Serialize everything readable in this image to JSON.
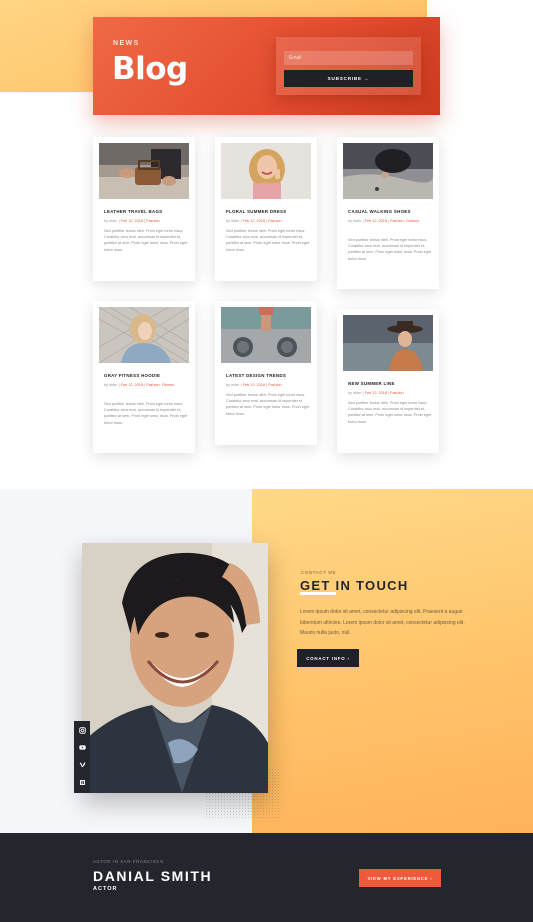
{
  "colors": {
    "accent": "#ef5a3c",
    "hero_start": "#ef6a47",
    "hero_end": "#cc3b1f",
    "dark": "#1e2128",
    "footer_bg": "#23262c",
    "yellow_start": "#ffd988",
    "yellow_end": "#ffb25a",
    "light_bg": "#f6f7fb"
  },
  "hero": {
    "kicker": "NEWS",
    "title": "Blog",
    "email_placeholder": "Email",
    "subscribe_label": "SUBSCRIBE",
    "subscribe_arrow": "→"
  },
  "posts": [
    {
      "title": "LEATHER TRAVEL BAGS",
      "author": "by elder",
      "date": "Feb 12, 2018",
      "category": "Fashion",
      "excerpt": "Sed porttitor lectus nibh. Proin eget tortor risus. Curabitur arcu erat, accumsan id imperdiet et, porttitor at sem. Proin eget tortor risus. Proin eget tortor risus.",
      "image": "hands-with-leather-bag"
    },
    {
      "title": "FLORAL SUMMER DRESS",
      "author": "by elder",
      "date": "Feb 12, 2018",
      "category": "Fashion",
      "excerpt": "Sed porttitor lectus nibh. Proin eget tortor risus. Curabitur arcu erat, accumsan id imperdiet et, porttitor at sem. Proin eget tortor risus. Proin eget tortor risus.",
      "image": "smiling-blonde-woman"
    },
    {
      "title": "CASUAL WALKING SHOES",
      "author": "by elder",
      "date": "Feb 12, 2018",
      "category": "Fashion, Outdoor",
      "excerpt": "Sed porttitor lectus nibh. Proin eget tortor risus. Curabitur arcu erat, accumsan id imperdiet et, porttitor at sem. Proin eget tortor risus. Proin eget tortor risus.",
      "image": "person-at-water-edge"
    },
    {
      "title": "GRAY FITNESS HOODIE",
      "author": "by elder",
      "date": "Feb 12, 2018",
      "category": "Fashion, Fitness",
      "excerpt": "Sed porttitor lectus nibh. Proin eget tortor risus. Curabitur arcu erat, accumsan id imperdiet et, porttitor at sem. Proin eget tortor risus. Proin eget tortor risus.",
      "image": "woman-in-hoodie"
    },
    {
      "title": "LATEST DESIGN TRENDS",
      "author": "by elder",
      "date": "Feb 12, 2018",
      "category": "Fashion",
      "excerpt": "Sed porttitor lectus nibh. Proin eget tortor risus. Curabitur arcu erat, accumsan id imperdiet et, porttitor at sem. Proin eget tortor risus. Proin eget tortor risus.",
      "image": "laundromat-machines"
    },
    {
      "title": "NEW SUMMER LINE",
      "author": "by elder",
      "date": "Feb 12, 2018",
      "category": "Fashion",
      "excerpt": "Sed porttitor lectus nibh. Proin eget tortor risus. Curabitur arcu erat, accumsan id imperdiet et, porttitor at sem. Proin eget tortor risus. Proin eget tortor risus.",
      "image": "woman-in-hat"
    }
  ],
  "contact": {
    "kicker": "CONTACT ME",
    "title": "GET IN TOUCH",
    "body": "Lorem ipsum dolor sit amet, consectetur adipiscing elit. Praesent a augue bibendum ultricies. Lorem ipsum dolor sit amet, consectetur adipiscing elit. Mauris nulla justo, nisl.",
    "button_label": "CONACT INFO",
    "button_arrow": "›",
    "social_icons": [
      "instagram-icon",
      "youtube-icon",
      "vimeo-icon",
      "imdb-icon"
    ]
  },
  "footer": {
    "kicker": "ACTOR IN SAN FRANCISCO",
    "name": "DANIAL SMITH",
    "role": "ACTOR",
    "button_label": "VIEW MY EXPERIENCE",
    "button_arrow": "›"
  }
}
